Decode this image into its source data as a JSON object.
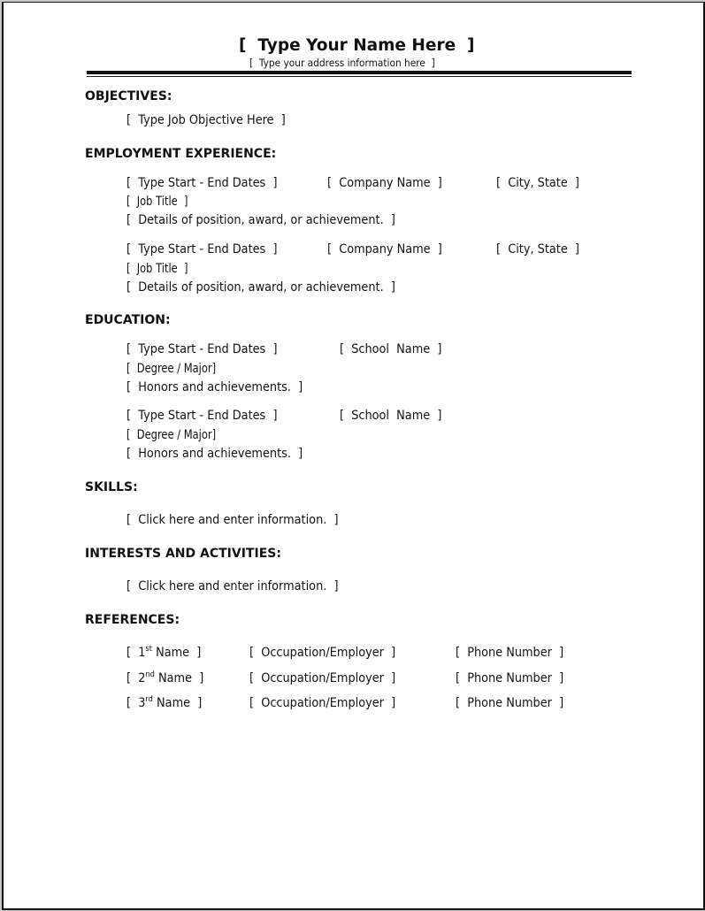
{
  "header": {
    "name": "[  Type Your Name Here  ]",
    "address": "[  Type your address information here  ]"
  },
  "sections": {
    "objectives": {
      "heading": "OBJECTIVES:",
      "text": "[  Type Job Objective Here  ]"
    },
    "employment": {
      "heading": "EMPLOYMENT EXPERIENCE:",
      "entries": [
        {
          "dates": "[  Type Start - End Dates  ]",
          "company": "[  Company Name  ]",
          "location": "[  City, State  ]",
          "job_title": "[  Job Title  ]",
          "details": "[  Details of position, award, or achievement.  ]"
        },
        {
          "dates": "[  Type Start - End Dates  ]",
          "company": "[  Company Name  ]",
          "location": "[  City, State  ]",
          "job_title": "[  Job Title  ]",
          "details": "[  Details of position, award, or achievement.  ]"
        }
      ]
    },
    "education": {
      "heading": "EDUCATION:",
      "entries": [
        {
          "dates": "[  Type Start - End Dates  ]",
          "school": "[  School  Name  ]",
          "degree": "[  Degree / Major]",
          "honors": "[  Honors and achievements.  ]"
        },
        {
          "dates": "[  Type Start - End Dates  ]",
          "school": "[  School  Name  ]",
          "degree": "[  Degree / Major]",
          "honors": "[  Honors and achievements.  ]"
        }
      ]
    },
    "skills": {
      "heading": "SKILLS:",
      "text": "[  Click here and enter information.  ]"
    },
    "interests": {
      "heading": "INTERESTS AND ACTIVITIES:",
      "text": "[  Click here and enter information.  ]"
    },
    "references": {
      "heading": "REFERENCES:",
      "entries": [
        {
          "name_prefix": "[  1",
          "ordinal": "st",
          "name_suffix": " Name  ]",
          "occupation": "[  Occupation/Employer  ]",
          "phone": "[  Phone Number  ]"
        },
        {
          "name_prefix": "[  2",
          "ordinal": "nd",
          "name_suffix": " Name  ]",
          "occupation": "[  Occupation/Employer  ]",
          "phone": "[  Phone Number  ]"
        },
        {
          "name_prefix": "[  3",
          "ordinal": "rd",
          "name_suffix": " Name  ]",
          "occupation": "[  Occupation/Employer  ]",
          "phone": "[  Phone Number  ]"
        }
      ]
    }
  }
}
